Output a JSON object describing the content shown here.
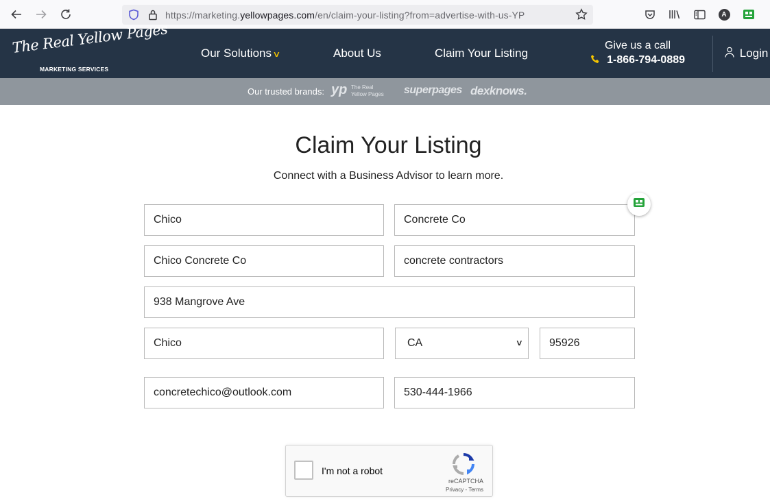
{
  "browser": {
    "url_prefix": "https://marketing.",
    "url_host": "yellowpages.com",
    "url_path": "/en/claim-your-listing?from=advertise-with-us-YP",
    "avatar_letter": "A"
  },
  "header": {
    "logo_text": "The Real Yellow Pages",
    "logo_sub": "MARKETING SERVICES",
    "nav": [
      {
        "label": "Our Solutions"
      },
      {
        "label": "About Us"
      },
      {
        "label": "Claim Your Listing"
      }
    ],
    "call_title": "Give us a call",
    "phone": "1-866-794-0889",
    "login": "Login"
  },
  "brands": {
    "label": "Our trusted brands:",
    "yp": "yp",
    "yp_sub_1": "The Real",
    "yp_sub_2": "Yellow Pages",
    "superpages": "superpages",
    "dexknows": "dexknows."
  },
  "main": {
    "title": "Claim Your Listing",
    "subtitle": "Connect with a Business Advisor to learn more."
  },
  "form": {
    "first_name": "Chico",
    "last_name": "Concrete Co",
    "business_name": "Chico Concrete Co",
    "category": "concrete contractors",
    "address": "938 Mangrove Ave",
    "city": "Chico",
    "state": "CA",
    "zip": "95926",
    "email": "concretechico@outlook.com",
    "phone": "530-444-1966"
  },
  "captcha": {
    "label": "I'm not a robot",
    "brand": "reCAPTCHA",
    "terms": "Privacy - Terms"
  },
  "colors": {
    "header_bg": "#253446",
    "brand_strip_bg": "#8f969d",
    "accent_yellow": "#f5c400"
  }
}
